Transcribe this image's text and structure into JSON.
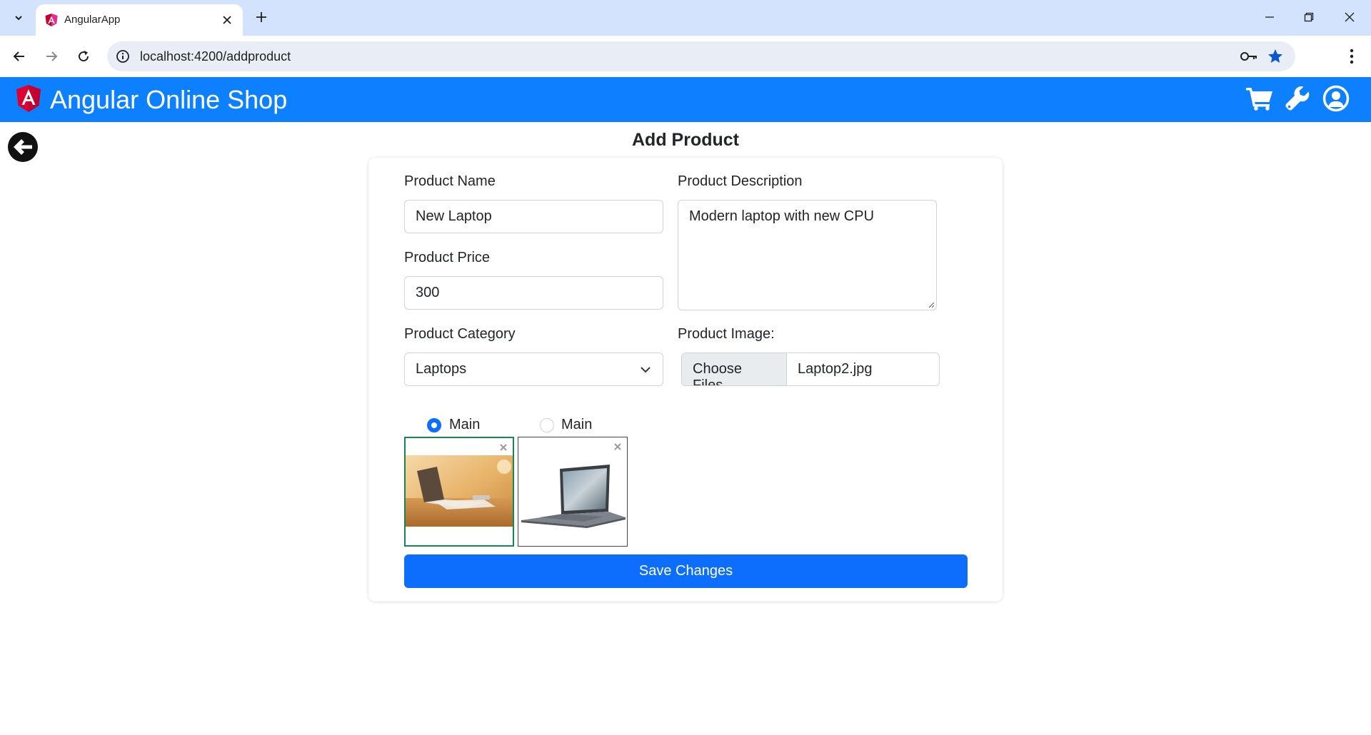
{
  "browser": {
    "tab_title": "AngularApp",
    "url": "localhost:4200/addproduct"
  },
  "header": {
    "brand": "Angular Online Shop",
    "brand_color": "#0d80ff"
  },
  "page": {
    "title": "Add Product"
  },
  "form": {
    "name_label": "Product Name",
    "name_value": "New Laptop",
    "description_label": "Product Description",
    "description_value": "Modern laptop with new CPU",
    "price_label": "Product Price",
    "price_value": "300",
    "category_label": "Product Category",
    "category_value": "Laptops",
    "image_label": "Product Image:",
    "choose_files_label": "Choose Files",
    "file_name": "Laptop2.jpg",
    "images": [
      {
        "radio_label": "Main",
        "is_main": true
      },
      {
        "radio_label": "Main",
        "is_main": false
      }
    ],
    "save_label": "Save Changes",
    "accent_color": "#0d6efd",
    "selected_border_color": "#198754"
  }
}
